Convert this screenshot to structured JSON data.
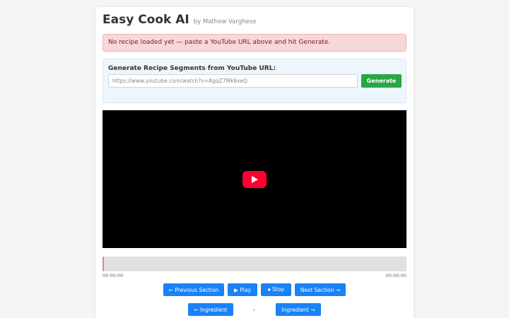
{
  "header": {
    "title": "Easy Cook AI",
    "byline": "by Mathew Varghese"
  },
  "alert": {
    "message": "No recipe loaded yet — paste a YouTube URL above and hit Generate."
  },
  "generator": {
    "label": "Generate Recipe Segments from YouTube URL:",
    "url_placeholder": "https://www.youtube.com/watch?v=AgqZ7Mk6xeQ",
    "url_value": "",
    "generate_label": "Generate"
  },
  "player": {
    "play_icon": "youtube-play-icon"
  },
  "progress": {
    "fraction": 0,
    "current_time": "00:00:00",
    "total_time": "00:00:00"
  },
  "controls": {
    "prev_section": "← Previous Section",
    "play": "▶ Play",
    "stop": "⏹ Stop",
    "next_section": "Next Section →"
  },
  "ingredients": {
    "prev": "← Ingredient",
    "separator": "-",
    "next": "Ingredient →"
  },
  "colors": {
    "accent_blue": "#1a82f7",
    "generate_green": "#28a745",
    "alert_bg": "#f8d7da",
    "youtube_red": "#ff0033"
  }
}
